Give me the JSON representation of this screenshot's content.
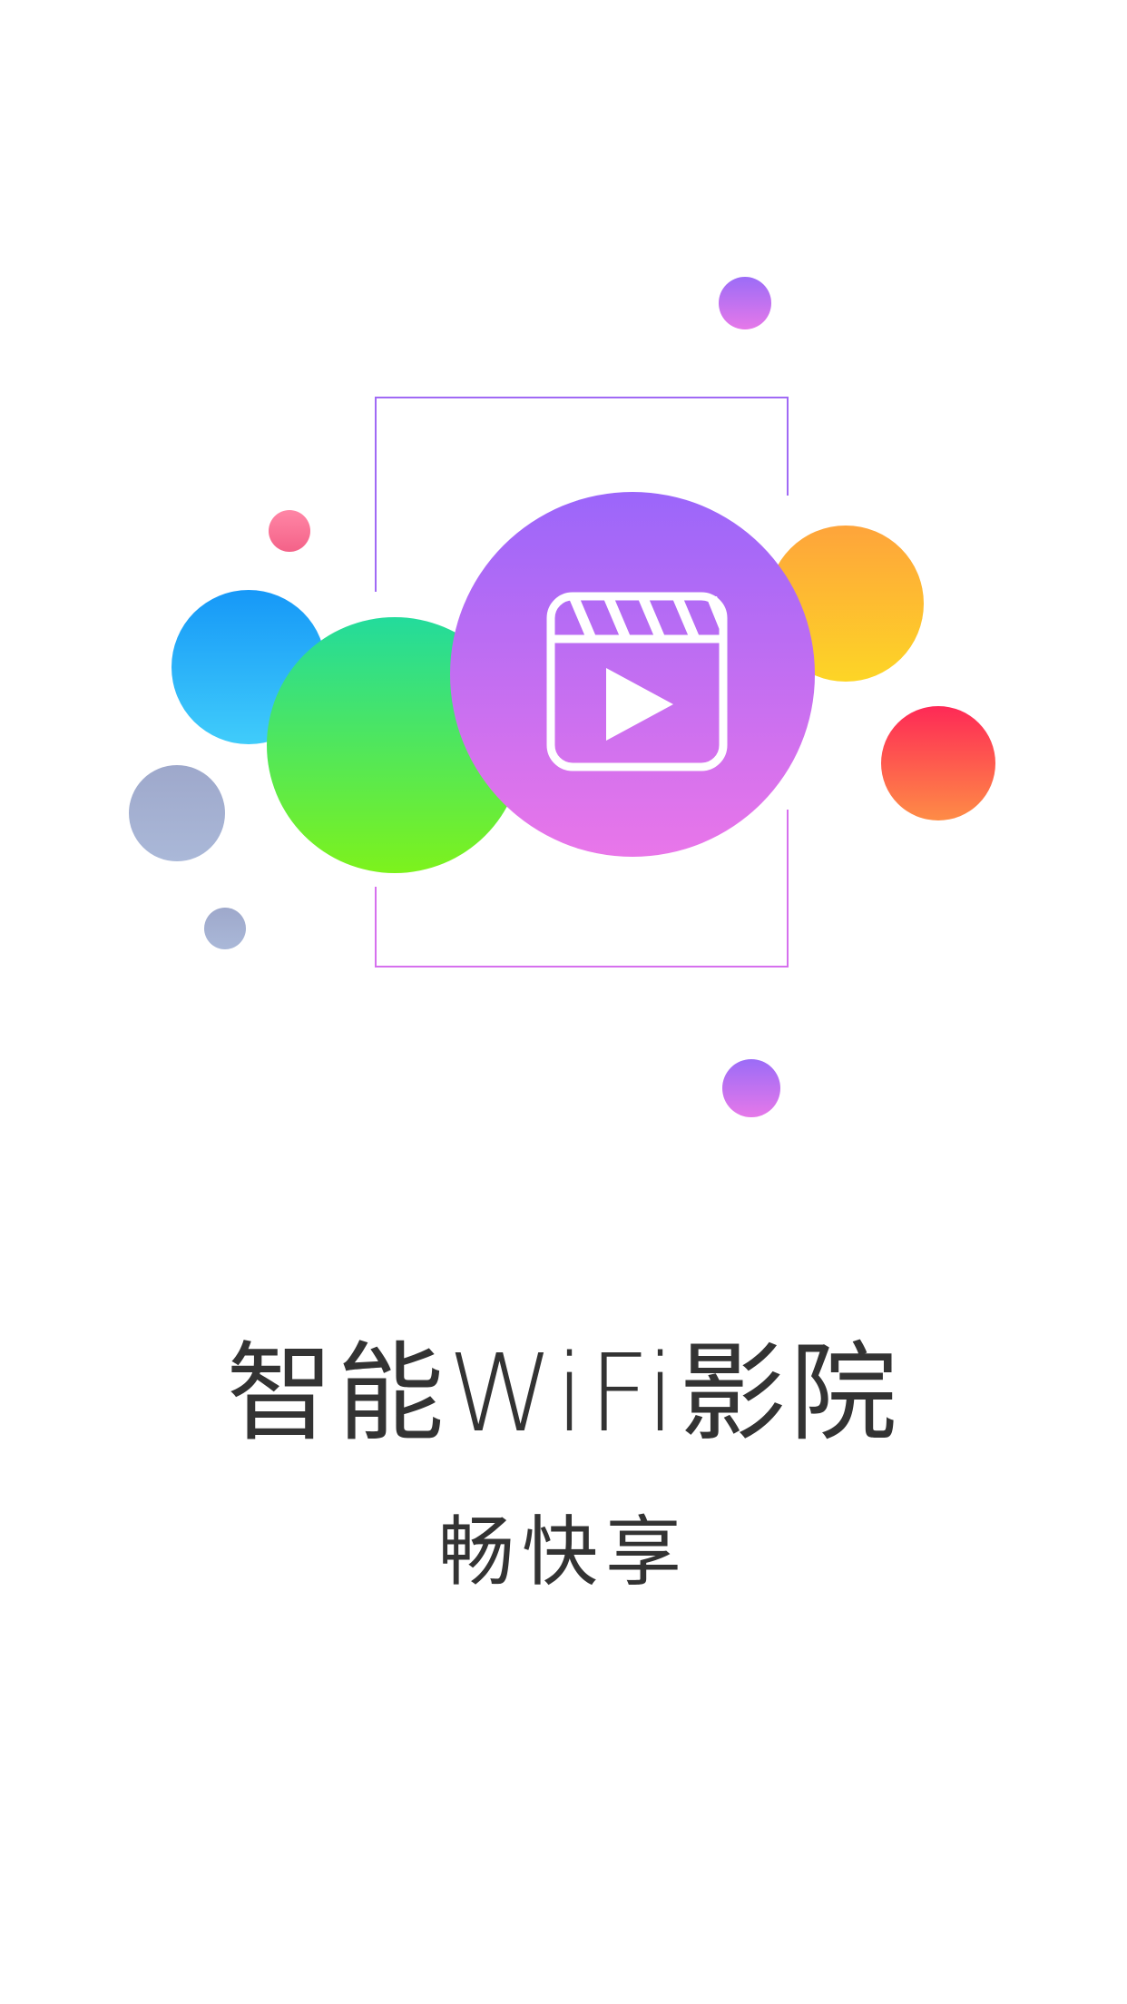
{
  "splash": {
    "title": "智能WiFi影院",
    "subtitle": "畅快享",
    "logo_icon": "clapperboard-play-icon"
  },
  "colors": {
    "frame_gradient": [
      "#9b66fa",
      "#e976e9"
    ],
    "text": "#333333",
    "background": "#ffffff",
    "bubble_purple": [
      "#9b66fa",
      "#e976e9"
    ],
    "bubble_green": [
      "#23db9c",
      "#7df21c"
    ],
    "bubble_blue": [
      "#1698f8",
      "#40ccfa"
    ],
    "bubble_orange": [
      "#fea43b",
      "#fdd526"
    ],
    "bubble_red": [
      "#fe2956",
      "#fe8c46"
    ],
    "bubble_gray": [
      "#9ea8cb",
      "#aab8d8"
    ],
    "bubble_pink": [
      "#ff86a6",
      "#f46288"
    ]
  }
}
